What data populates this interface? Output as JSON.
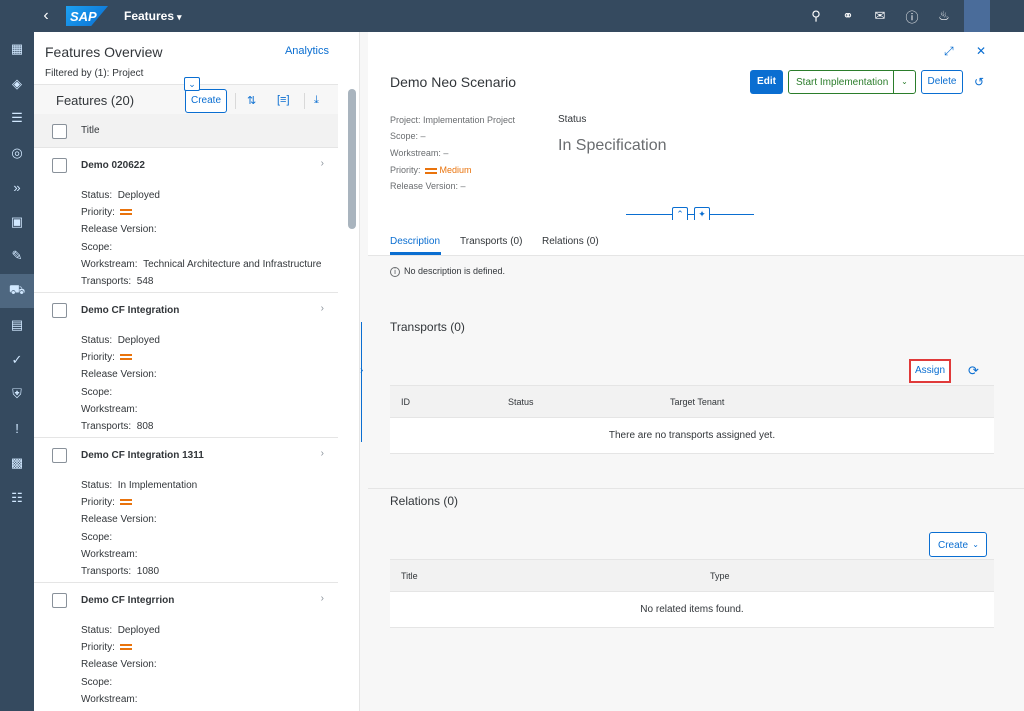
{
  "shell": {
    "app_title": "Features",
    "logo": "SAP",
    "icons": [
      "search-icon",
      "headset-icon",
      "chat-icon",
      "help-icon",
      "bell-icon"
    ]
  },
  "rail": {
    "items": [
      "dashboard-icon",
      "cube-icon",
      "checklist-icon",
      "target-icon",
      "forward-icon",
      "screen-icon",
      "edit-icon",
      "truck-icon",
      "clipboard-icon",
      "clipboard-check-icon",
      "shield-icon",
      "alert-icon",
      "report-icon",
      "org-icon"
    ],
    "active_index": 7
  },
  "master": {
    "title": "Features Overview",
    "analytics": "Analytics",
    "filtered": "Filtered by (1): Project",
    "count_label": "Features (20)",
    "create": "Create",
    "col_title": "Title",
    "labels": {
      "status": "Status:",
      "priority": "Priority:",
      "release": "Release Version:",
      "scope": "Scope:",
      "workstream": "Workstream:",
      "transports": "Transports:"
    },
    "items": [
      {
        "title": "Demo 020622",
        "status": "Deployed",
        "workstream": "Technical Architecture and Infrastructure",
        "transports": "548"
      },
      {
        "title": "Demo CF Integration",
        "status": "Deployed",
        "workstream": "",
        "transports": "808"
      },
      {
        "title": "Demo CF Integration 1311",
        "status": "In Implementation",
        "workstream": "",
        "transports": "1080"
      },
      {
        "title": "Demo CF Integrrion",
        "status": "Deployed",
        "workstream": "",
        "transports": ""
      }
    ]
  },
  "detail": {
    "title": "Demo Neo Scenario",
    "edit": "Edit",
    "start_impl": "Start Implementation",
    "delete": "Delete",
    "project": "Project: Implementation Project",
    "scope": "Scope: –",
    "workstream": "Workstream: –",
    "priority_label": "Priority:",
    "priority_value": "Medium",
    "release": "Release Version: –",
    "status_label": "Status",
    "status_value": "In Specification",
    "tabs": [
      "Description",
      "Transports (0)",
      "Relations (0)"
    ],
    "no_desc": "No description is defined.",
    "transports_title": "Transports (0)",
    "assign": "Assign",
    "transports_cols": [
      "ID",
      "Status",
      "Target Tenant"
    ],
    "transports_empty": "There are no transports assigned yet.",
    "relations_title": "Relations (0)",
    "relations_create": "Create",
    "relations_cols": [
      "Title",
      "Type"
    ],
    "relations_empty": "No related items found."
  },
  "colors": {
    "shell": "#354a5f",
    "accent": "#0a6ed1",
    "positive": "#2b7d2b",
    "medium_priority": "#e9730c",
    "highlight_border": "#e03a3a"
  }
}
